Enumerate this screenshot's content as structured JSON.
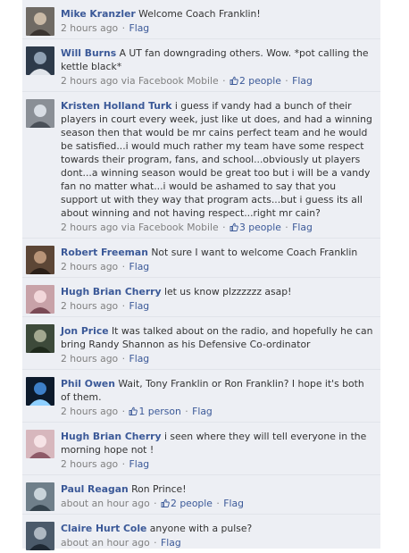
{
  "comments": [
    {
      "author": "Mike Kranzler",
      "text": "Welcome Coach Franklin!",
      "time": "2 hours ago",
      "via": "",
      "likes": "",
      "flag": "Flag",
      "avatar": "profile-photo-icon"
    },
    {
      "author": "Will Burns",
      "text": "A UT fan downgrading others. Wow. *pot calling the kettle black*",
      "time": "2 hours ago",
      "via": "via Facebook Mobile",
      "likes": "2 people",
      "flag": "Flag",
      "avatar": "profile-photo-icon"
    },
    {
      "author": "Kristen Holland Turk",
      "text": "i guess if vandy had a bunch of their players in court every week, just like ut does, and had a winning season then that would be mr cains perfect team and he would be satisfied...i would much rather my team have some respect towards their program, fans, and school...obviously ut players dont...a winning season would be great too but i will be a vandy fan no matter what...i would be ashamed to say that you support ut with they way that program acts...but i guess its all about winning and not having respect...right mr cain?",
      "time": "2 hours ago",
      "via": "via Facebook Mobile",
      "likes": "3 people",
      "flag": "Flag",
      "avatar": "profile-photo-icon"
    },
    {
      "author": "Robert Freeman",
      "text": "Not sure I want to welcome Coach Franklin",
      "time": "2 hours ago",
      "via": "",
      "likes": "",
      "flag": "Flag",
      "avatar": "profile-photo-icon"
    },
    {
      "author": "Hugh Brian Cherry",
      "text": "let us know plzzzzzz asap!",
      "time": "2 hours ago",
      "via": "",
      "likes": "",
      "flag": "Flag",
      "avatar": "profile-photo-icon"
    },
    {
      "author": "Jon Price",
      "text": "It was talked about on the radio, and hopefully he can bring Randy Shannon as his Defensive Co-ordinator",
      "time": "2 hours ago",
      "via": "",
      "likes": "",
      "flag": "Flag",
      "avatar": "profile-photo-icon"
    },
    {
      "author": "Phil Owen",
      "text": "Wait, Tony Franklin or Ron Franklin? I hope it's both of them.",
      "time": "2 hours ago",
      "via": "",
      "likes": "1 person",
      "flag": "Flag",
      "avatar": "profile-photo-icon"
    },
    {
      "author": "Hugh Brian Cherry",
      "text": "i seen where they will tell everyone in the morning hope not !",
      "time": "2 hours ago",
      "via": "",
      "likes": "",
      "flag": "Flag",
      "avatar": "profile-photo-icon"
    },
    {
      "author": "Paul Reagan",
      "text": "Ron Prince!",
      "time": "about an hour ago",
      "via": "",
      "likes": "2 people",
      "flag": "Flag",
      "avatar": "profile-photo-icon"
    },
    {
      "author": "Claire Hurt Cole",
      "text": "anyone with a pulse?",
      "time": "about an hour ago",
      "via": "",
      "likes": "",
      "flag": "Flag",
      "avatar": "profile-photo-icon"
    }
  ],
  "separator": "·",
  "colors": {
    "link": "#3b5998",
    "meta": "#808080",
    "panel": "#edeff4",
    "divider": "#e1e4ea"
  }
}
